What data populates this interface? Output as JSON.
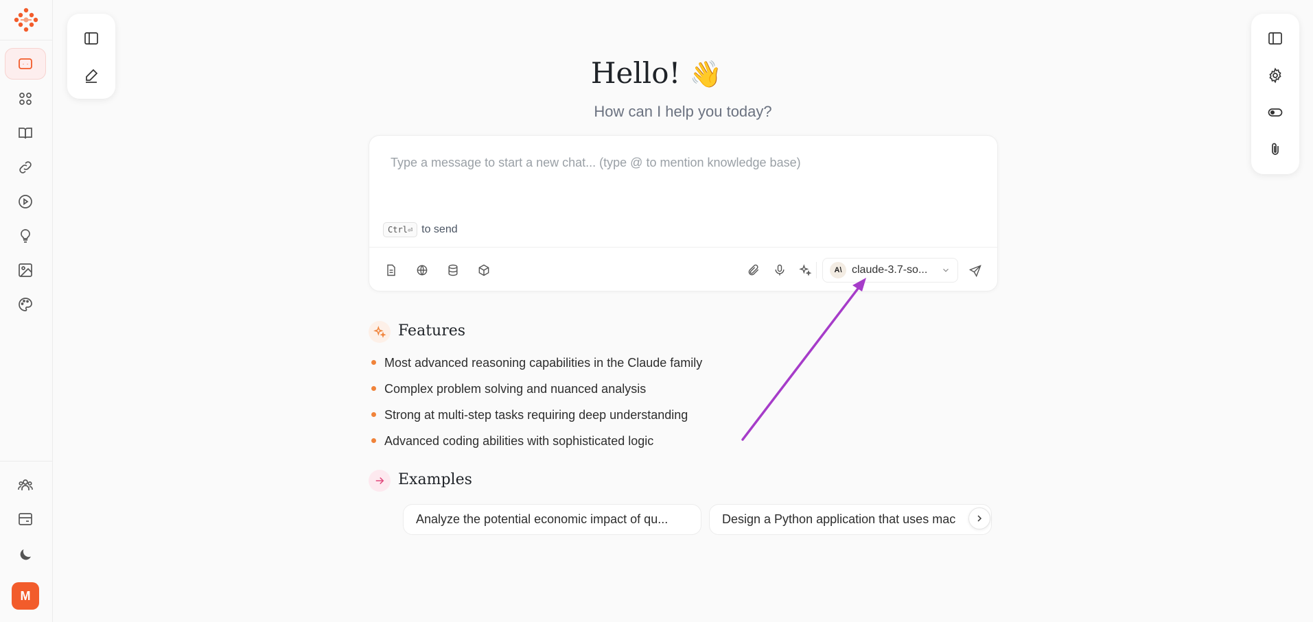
{
  "greeting": {
    "title": "Hello!",
    "emoji": "👋",
    "subtitle": "How can I help you today?"
  },
  "composer": {
    "placeholder": "Type a message to start a new chat... (type @ to mention knowledge base)",
    "send_hint_key": "Ctrl⏎",
    "send_hint_text": "to send",
    "model": {
      "badge": "A\\",
      "name": "claude-3.7-so..."
    }
  },
  "features": {
    "title": "Features",
    "items": [
      "Most advanced reasoning capabilities in the Claude family",
      "Complex problem solving and nuanced analysis",
      "Strong at multi-step tasks requiring deep understanding",
      "Advanced coding abilities with sophisticated logic"
    ]
  },
  "examples": {
    "title": "Examples",
    "items": [
      "Analyze the potential economic impact of qu...",
      "Design a Python application that uses mac"
    ]
  },
  "user": {
    "avatar_initial": "M"
  },
  "colors": {
    "accent": "#f25c2b",
    "annotation_arrow": "#a63cc9",
    "bullet": "#f0833a"
  }
}
